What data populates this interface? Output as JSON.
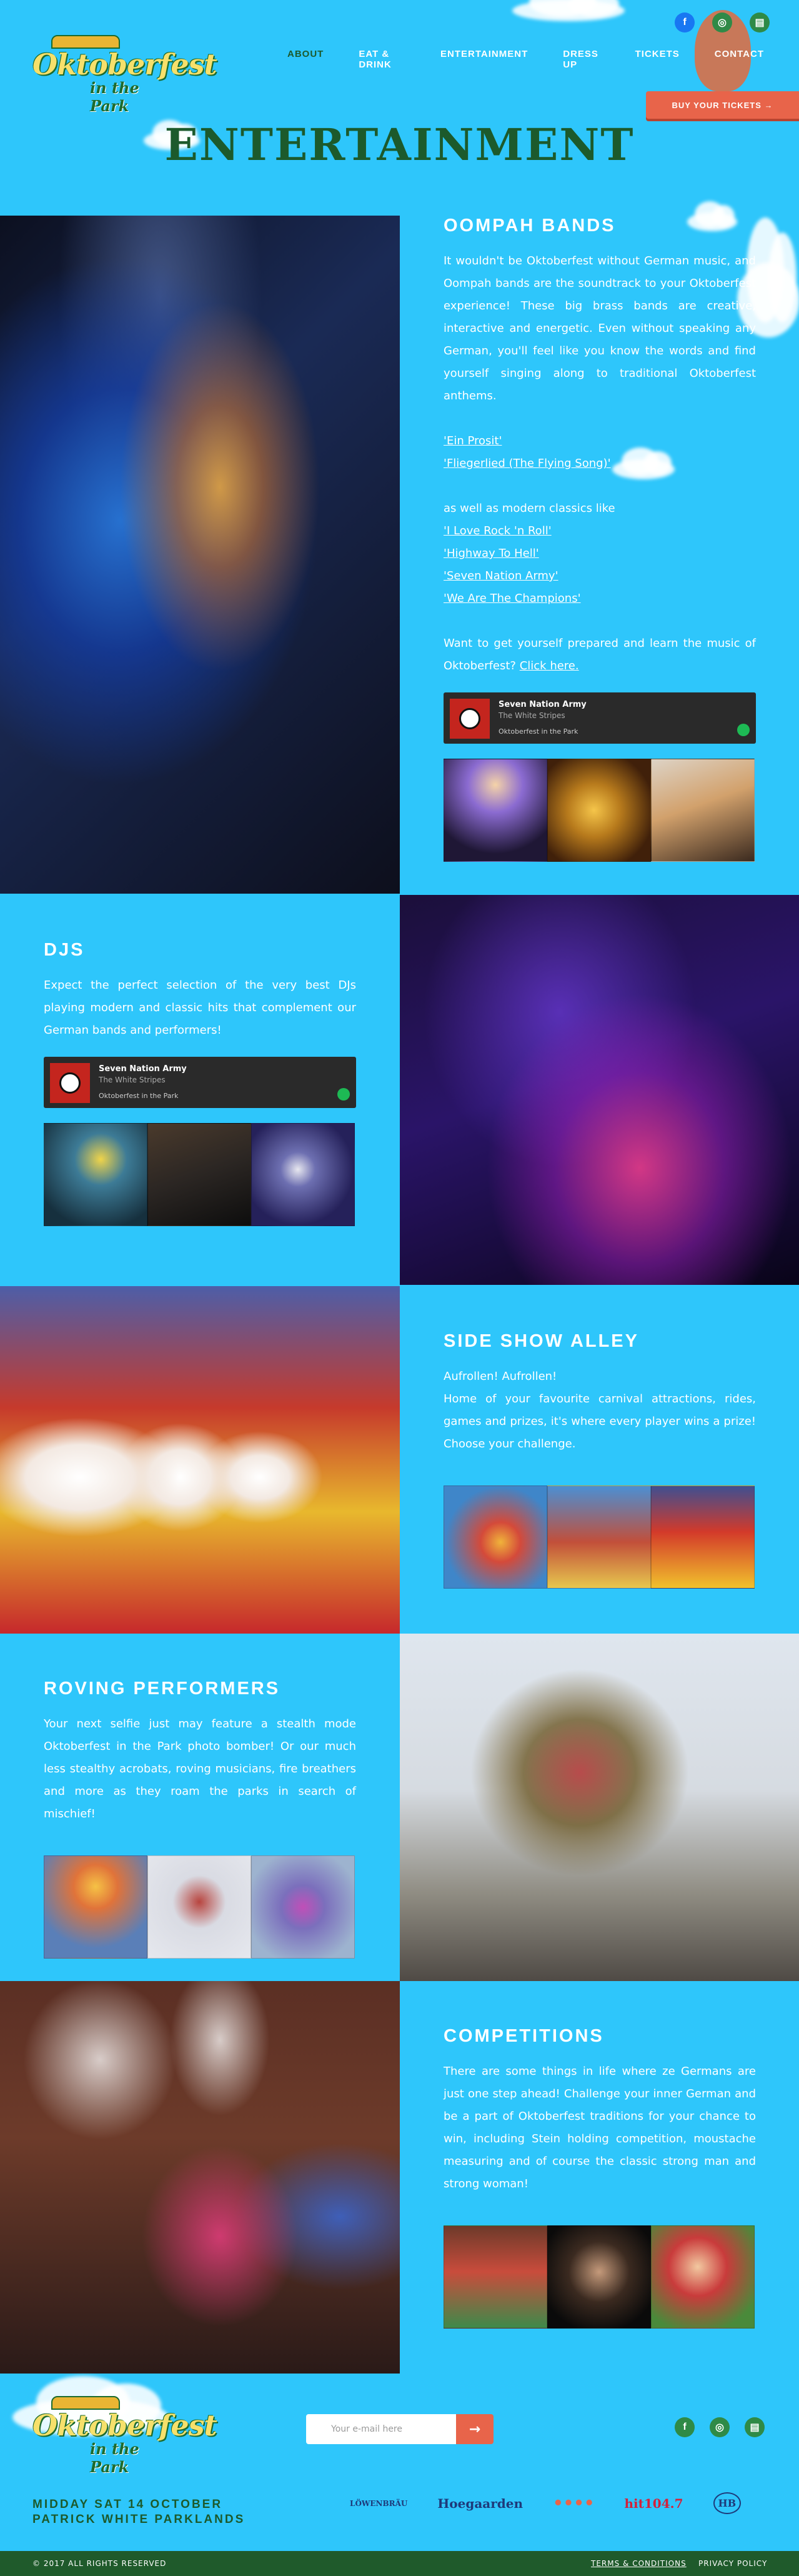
{
  "header": {
    "logo_main": "Oktoberfest",
    "logo_sub": "in the Park",
    "nav": [
      "ABOUT",
      "EAT & DRINK",
      "ENTERTAINMENT",
      "DRESS UP",
      "TICKETS",
      "CONTACT"
    ],
    "buy_tickets": "BUY YOUR TICKETS →",
    "social": [
      "f",
      "◎",
      "▤"
    ]
  },
  "page_title": "ENTERTAINMENT",
  "oompah": {
    "title": "OOMPAH BANDS",
    "intro": "It wouldn't be Oktoberfest without German music, and Oompah bands are the soundtrack to your Oktoberfest experience! These big brass bands are creative, interactive and energetic. Even without speaking any German, you'll feel like you know the words and find yourself singing along to traditional Oktoberfest anthems.",
    "songs_traditional": [
      "'Ein Prosit'",
      "'Fliegerlied (The Flying Song)'"
    ],
    "modern_intro": "as well as modern classics like",
    "songs_modern": [
      "'I Love Rock 'n Roll'",
      "'Highway To Hell'",
      "'Seven Nation Army'",
      "'We Are The Champions'"
    ],
    "learn_text": "Want to get yourself prepared and learn the music of Oktoberfest?",
    "learn_link": "Click here.",
    "player": {
      "title": "Seven Nation Army",
      "artist": "The White Stripes",
      "from": "Oktoberfest in the Park"
    }
  },
  "djs": {
    "title": "DJS",
    "text": "Expect the perfect selection of the very best DJs playing modern and classic hits that complement our German bands and performers!",
    "player": {
      "title": "Seven Nation Army",
      "artist": "The White Stripes",
      "from": "Oktoberfest in the Park"
    }
  },
  "sideshow": {
    "title": "SIDE SHOW ALLEY",
    "line1": "Aufrollen! Aufrollen!",
    "text": "Home of your favourite carnival attractions, rides, games and prizes, it's where every player wins a prize! Choose your challenge."
  },
  "roving": {
    "title": "ROVING PERFORMERS",
    "text": "Your next selfie just may feature a stealth mode Oktoberfest in the Park photo bomber! Or our much less stealthy acrobats, roving musicians, fire breathers and more as they roam the parks in search of mischief!"
  },
  "competitions": {
    "title": "COMPETITIONS",
    "text": "There are some things in life where ze Germans are just one step ahead! Challenge your inner German and be a part of Oktoberfest traditions for your chance to win, including Stein holding competition, moustache measuring and of course the classic strong man and strong woman!"
  },
  "footer": {
    "email_placeholder": "Your e-mail here",
    "email_btn": "→",
    "date_line1": "MIDDAY SAT 14 OCTOBER",
    "date_line2": "PATRICK WHITE PARKLANDS",
    "sponsors": [
      "LÖWENBRÄU",
      "Hoegaarden",
      "••••",
      "hit104.7",
      "HB"
    ],
    "copyright": "© 2017 ALL RIGHTS RESERVED",
    "terms": "TERMS & CONDITIONS",
    "privacy": "PRIVACY POLICY"
  }
}
